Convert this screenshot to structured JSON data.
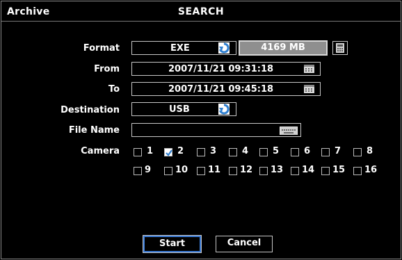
{
  "header": {
    "left_title": "Archive",
    "center_title": "SEARCH"
  },
  "form": {
    "format_label": "Format",
    "format_value": "EXE",
    "size_value": "4169 MB",
    "from_label": "From",
    "from_value": "2007/11/21 09:31:18",
    "to_label": "To",
    "to_value": "2007/11/21 09:45:18",
    "destination_label": "Destination",
    "destination_value": "USB",
    "filename_label": "File Name",
    "filename_value": "",
    "camera_label": "Camera"
  },
  "cameras": {
    "c1": "1",
    "c2": "2",
    "c3": "3",
    "c4": "4",
    "c5": "5",
    "c6": "6",
    "c7": "7",
    "c8": "8",
    "c9": "9",
    "c10": "10",
    "c11": "11",
    "c12": "12",
    "c13": "13",
    "c14": "14",
    "c15": "15",
    "c16": "16",
    "checked": [
      "2"
    ]
  },
  "buttons": {
    "start": "Start",
    "cancel": "Cancel"
  },
  "icons": {
    "refresh": "refresh-icon",
    "calendar": "calendar-icon",
    "keyboard": "keyboard-icon",
    "calculator": "calculator-icon",
    "check": "checkmark-icon"
  },
  "colors": {
    "accent": "#3b7bd6",
    "refresh_blue": "#2f7fd0",
    "size_bg": "#8f8f8f"
  }
}
